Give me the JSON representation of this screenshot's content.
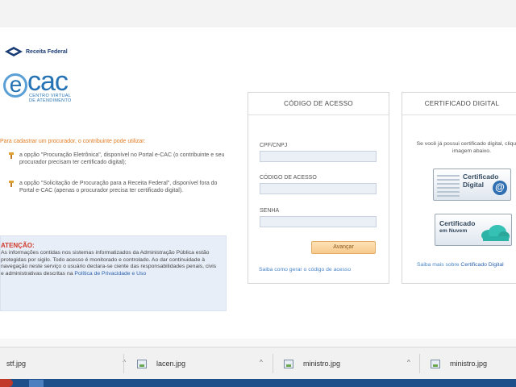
{
  "brand": {
    "receita_label": "Receita Federal",
    "ecac_wordmark": "cac",
    "ecac_e": "e",
    "ecac_sub_line1": "CENTRO VIRTUAL",
    "ecac_sub_line2": "DE ATENDIMENTO"
  },
  "left": {
    "intro": "Para cadastrar um procurador, o contribuinte pode utilizar:",
    "option1": "a opção \"Procuração Eletrônica\", disponível no Portal e-CAC (o contribuinte e seu procurador precisam ter certificado digital);",
    "option2": "a opção \"Solicitação de Procuração para a Receita Federal\", disponível fora do Portal e-CAC (apenas o procurador precisa ter certificado digital)."
  },
  "alert": {
    "title": "ATENÇÃO:",
    "body": "As informações contidas nos sistemas informatizados da Administração Pública estão protegidas por sigilo. Todo acesso é monitorado e controlado. Ao dar continuidade à navegação neste serviço o usuário declara-se ciente das responsabilidades penais, civis e administrativas descritas na ",
    "link": "Política de Privacidade e Uso"
  },
  "access_panel": {
    "title": "CÓDIGO DE ACESSO",
    "cpf_label": "CPF/CNPJ",
    "code_label": "CÓDIGO DE ACESSO",
    "password_label": "SENHA",
    "cpf_value": "",
    "code_value": "",
    "password_value": "",
    "submit_label": "Avançar",
    "help_link": "Saiba como gerar o código de acesso"
  },
  "cert_panel": {
    "title": "CERTIFICADO DIGITAL",
    "text": "Se você já possui certificado digital, clique na imagem abaixo.",
    "btn1_line1": "Certificado",
    "btn1_line2": "Digital",
    "btn1_symbol": "@",
    "btn2_line1": "Certificado",
    "btn2_line2": "em Nuvem",
    "more_prefix": "Saiba mais sobre ",
    "more_link": "Certificado Digital"
  },
  "downloads": {
    "items": [
      {
        "name": "stf.jpg"
      },
      {
        "name": "lacen.jpg"
      },
      {
        "name": "ministro.jpg"
      },
      {
        "name": "ministro.jpg"
      }
    ],
    "chevron": "^"
  },
  "colors": {
    "brand_blue": "#2573b4",
    "alert_red": "#d0392b",
    "intro_orange": "#e07b22",
    "link_blue": "#4a86c8",
    "button_orange": "#f6c98d"
  }
}
